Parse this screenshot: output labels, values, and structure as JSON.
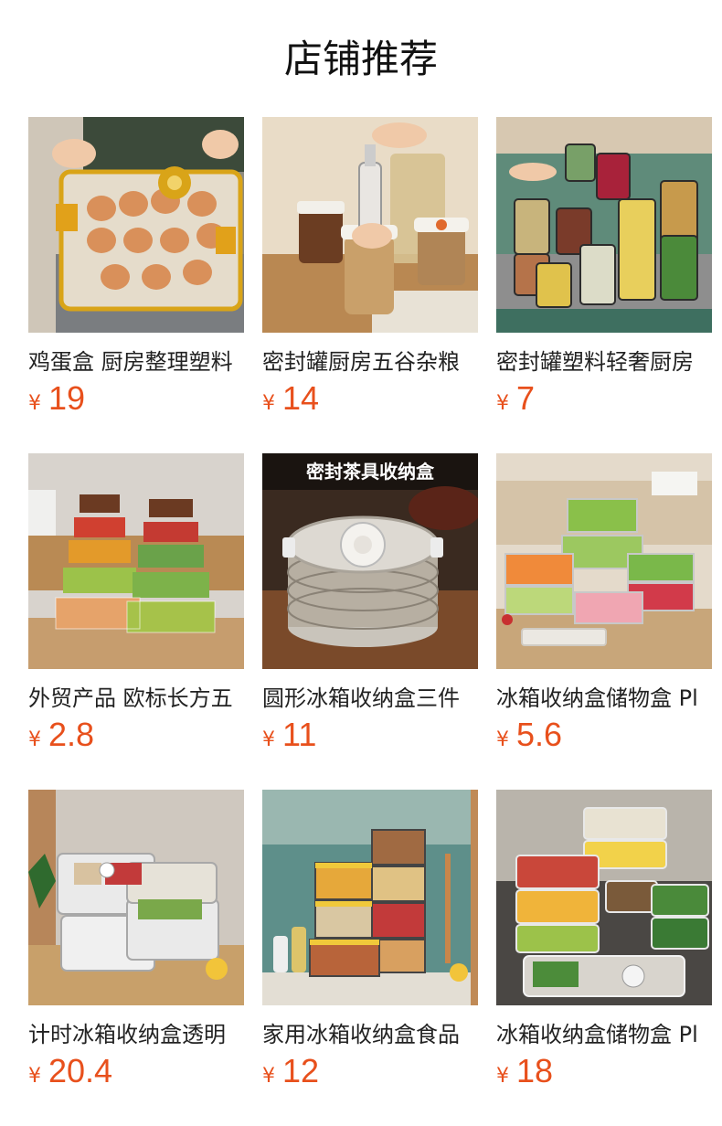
{
  "header": {
    "title": "店铺推荐"
  },
  "products": [
    {
      "name": "鸡蛋盒 厨房整理塑料",
      "currency": "¥",
      "price": "19",
      "image": "egg-box-photo"
    },
    {
      "name": "密封罐厨房五谷杂粮",
      "currency": "¥",
      "price": "14",
      "image": "grain-jar-photo"
    },
    {
      "name": "密封罐塑料轻奢厨房",
      "currency": "¥",
      "price": "7",
      "image": "sealed-jars-photo"
    },
    {
      "name": "外贸产品 欧标长方五",
      "currency": "¥",
      "price": "2.8",
      "image": "stacked-boxes-photo"
    },
    {
      "name": "圆形冰箱收纳盒三件",
      "currency": "¥",
      "price": "11",
      "image": "round-tea-box-photo",
      "overlay_text": "密封茶具收纳盒"
    },
    {
      "name": "冰箱收纳盒储物盒 Pl",
      "currency": "¥",
      "price": "5.6",
      "image": "fridge-boxes-photo"
    },
    {
      "name": "计时冰箱收纳盒透明",
      "currency": "¥",
      "price": "20.4",
      "image": "timer-boxes-photo"
    },
    {
      "name": "家用冰箱收纳盒食品",
      "currency": "¥",
      "price": "12",
      "image": "food-boxes-photo"
    },
    {
      "name": "冰箱收纳盒储物盒 Pl",
      "currency": "¥",
      "price": "18",
      "image": "fridge-storage-photo"
    }
  ],
  "colors": {
    "price": "#e8501c",
    "title": "#111111",
    "name": "#222222"
  }
}
